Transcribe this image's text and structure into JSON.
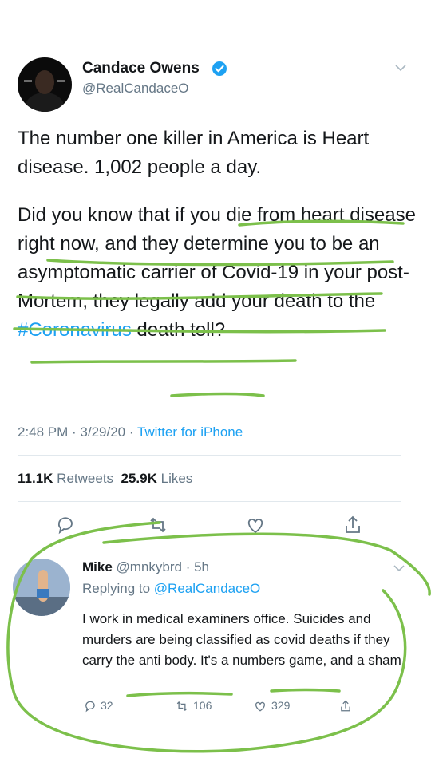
{
  "tweet": {
    "author_name": "Candace Owens",
    "handle": "@RealCandaceO",
    "paragraph1": "The number one killer in America is Heart disease. 1,002 people a day.",
    "paragraph2_main": "Did you know that if you die from heart disease right now, and they determine you to be an asymptomatic carrier of Covid-19 in your post-Mortem, they legally add your death to the ",
    "hashtag": "#Coronavirus",
    "paragraph2_end": " death toll?",
    "time": "2:48 PM · 3/29/20 · ",
    "source": "Twitter for iPhone",
    "retweets_count": "11.1K",
    "retweets_label": "Retweets",
    "likes_count": "25.9K",
    "likes_label": "Likes"
  },
  "reply": {
    "name": "Mike",
    "handle_time": "@mnkybrd · 5h",
    "replying_prefix": "Replying to ",
    "replying_to": "@RealCandaceO",
    "text": "I work in medical examiners office. Suicides and murders are being classified as covid deaths if they carry the anti body. It's a numbers game, and a sham.",
    "replies": "32",
    "retweets": "106",
    "likes": "329"
  },
  "icons": [
    "verified-badge-icon",
    "chevron-down-icon",
    "reply-icon",
    "retweet-icon",
    "like-icon",
    "share-icon"
  ],
  "colors": {
    "accent": "#1da1f2",
    "annotation_green": "#7cc04b",
    "muted": "#657786"
  }
}
